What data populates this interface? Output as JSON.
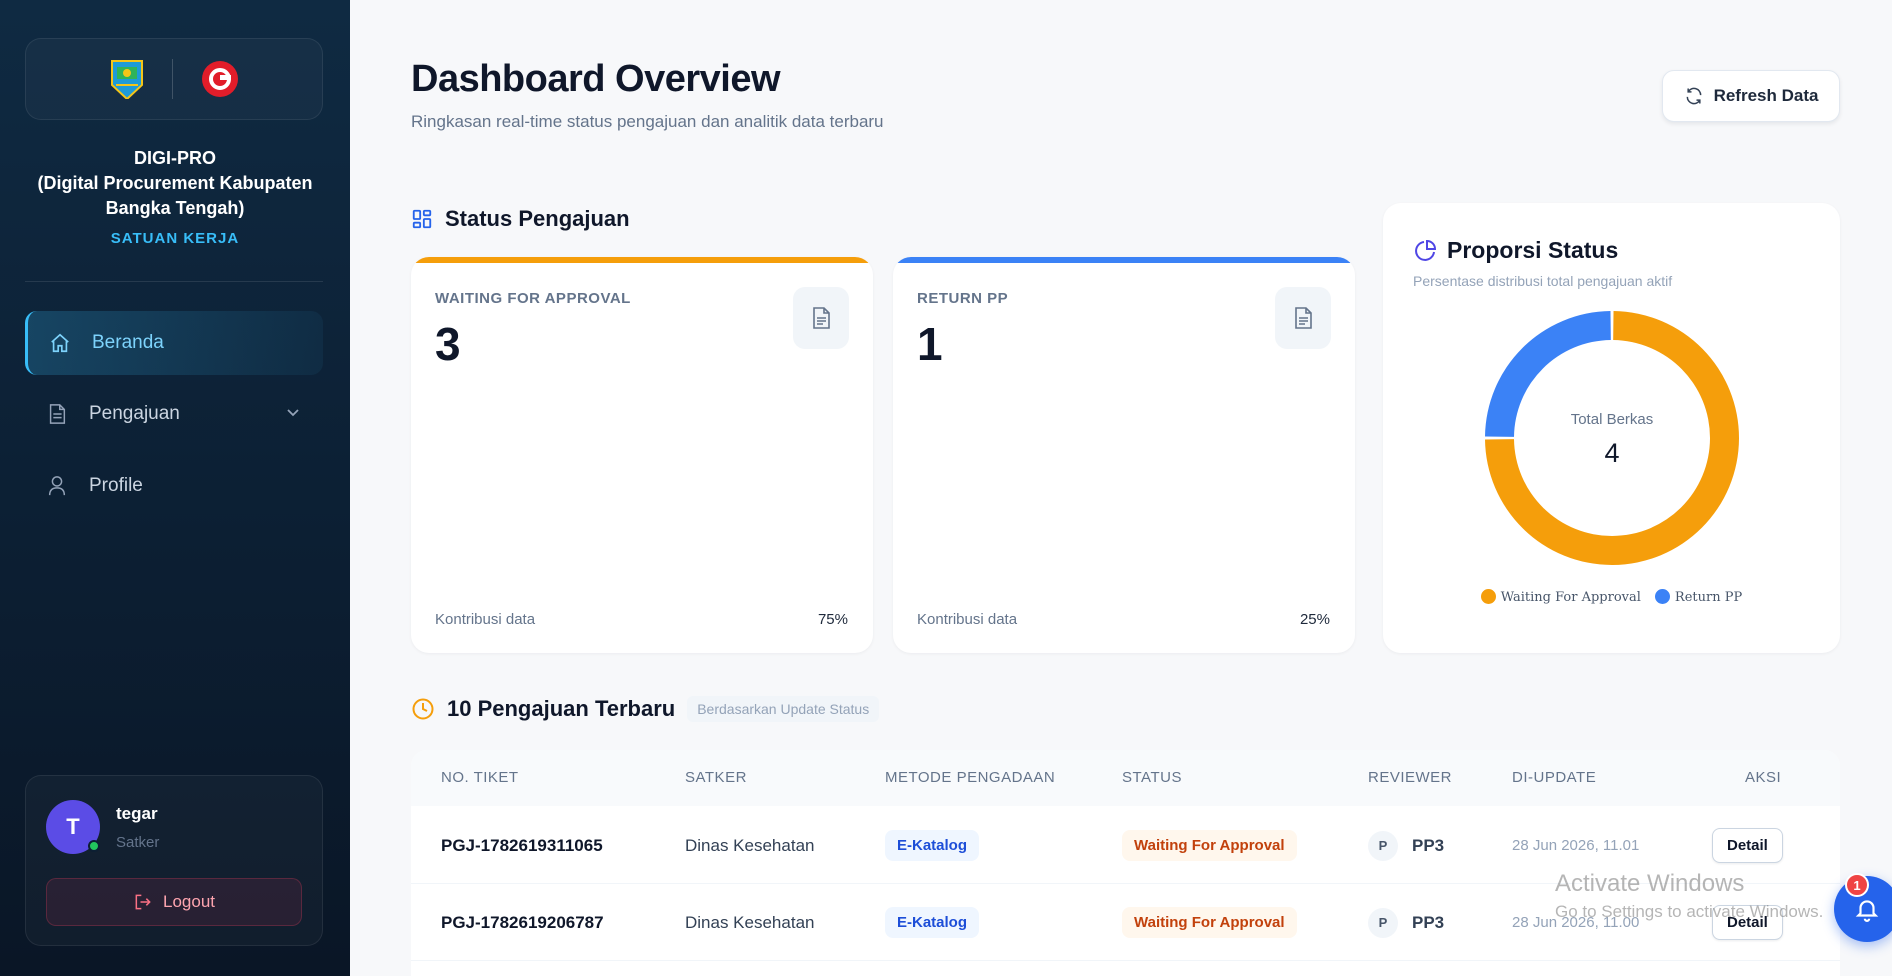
{
  "sidebar": {
    "brand_line1": "DIGI-PRO",
    "brand_line2": "(Digital Procurement Kabupaten",
    "brand_line3": "Bangka Tengah)",
    "role_label": "SATUAN KERJA",
    "nav": [
      {
        "label": "Beranda",
        "icon": "home-icon",
        "active": true
      },
      {
        "label": "Pengajuan",
        "icon": "document-icon",
        "active": false
      },
      {
        "label": "Profile",
        "icon": "user-icon",
        "active": false
      }
    ],
    "user": {
      "initial": "T",
      "name": "tegar",
      "role": "Satker"
    },
    "logout_label": "Logout"
  },
  "header": {
    "title": "Dashboard Overview",
    "subtitle": "Ringkasan real-time status pengajuan dan analitik data terbaru",
    "refresh_label": "Refresh Data"
  },
  "status_section": {
    "title": "Status Pengajuan",
    "cards": [
      {
        "label": "WAITING FOR APPROVAL",
        "value": "3",
        "foot": "Kontribusi data",
        "pct": "75%",
        "color": "#f59e0b"
      },
      {
        "label": "RETURN PP",
        "value": "1",
        "foot": "Kontribusi data",
        "pct": "25%",
        "color": "#3b82f6"
      }
    ]
  },
  "proportion": {
    "title": "Proporsi Status",
    "subtitle": "Persentase distribusi total pengajuan aktif",
    "center_label": "Total Berkas",
    "center_value": "4"
  },
  "chart_data": {
    "type": "pie",
    "categories": [
      "Waiting For Approval",
      "Return PP"
    ],
    "values": [
      3,
      1
    ],
    "colors": [
      "#f59e0b",
      "#3b82f6"
    ],
    "legend": "bottom"
  },
  "recent": {
    "title": "10 Pengajuan Terbaru",
    "badge": "Berdasarkan Update Status",
    "columns": [
      "NO. TIKET",
      "SATKER",
      "METODE PENGADAAN",
      "STATUS",
      "REVIEWER",
      "DI-UPDATE",
      "AKSI"
    ],
    "rows": [
      {
        "ticket": "PGJ-1782619311065",
        "satker": "Dinas Kesehatan",
        "method": "E-Katalog",
        "status": "Waiting For Approval",
        "reviewer_initial": "P",
        "reviewer": "PP3",
        "updated": "28 Jun 2026, 11.01",
        "action": "Detail"
      },
      {
        "ticket": "PGJ-1782619206787",
        "satker": "Dinas Kesehatan",
        "method": "E-Katalog",
        "status": "Waiting For Approval",
        "reviewer_initial": "P",
        "reviewer": "PP3",
        "updated": "28 Jun 2026, 11.00",
        "action": "Detail"
      }
    ]
  },
  "watermark": {
    "line1": "Activate Windows",
    "line2": "Go to Settings to activate Windows."
  },
  "notifications": {
    "count": "1"
  }
}
